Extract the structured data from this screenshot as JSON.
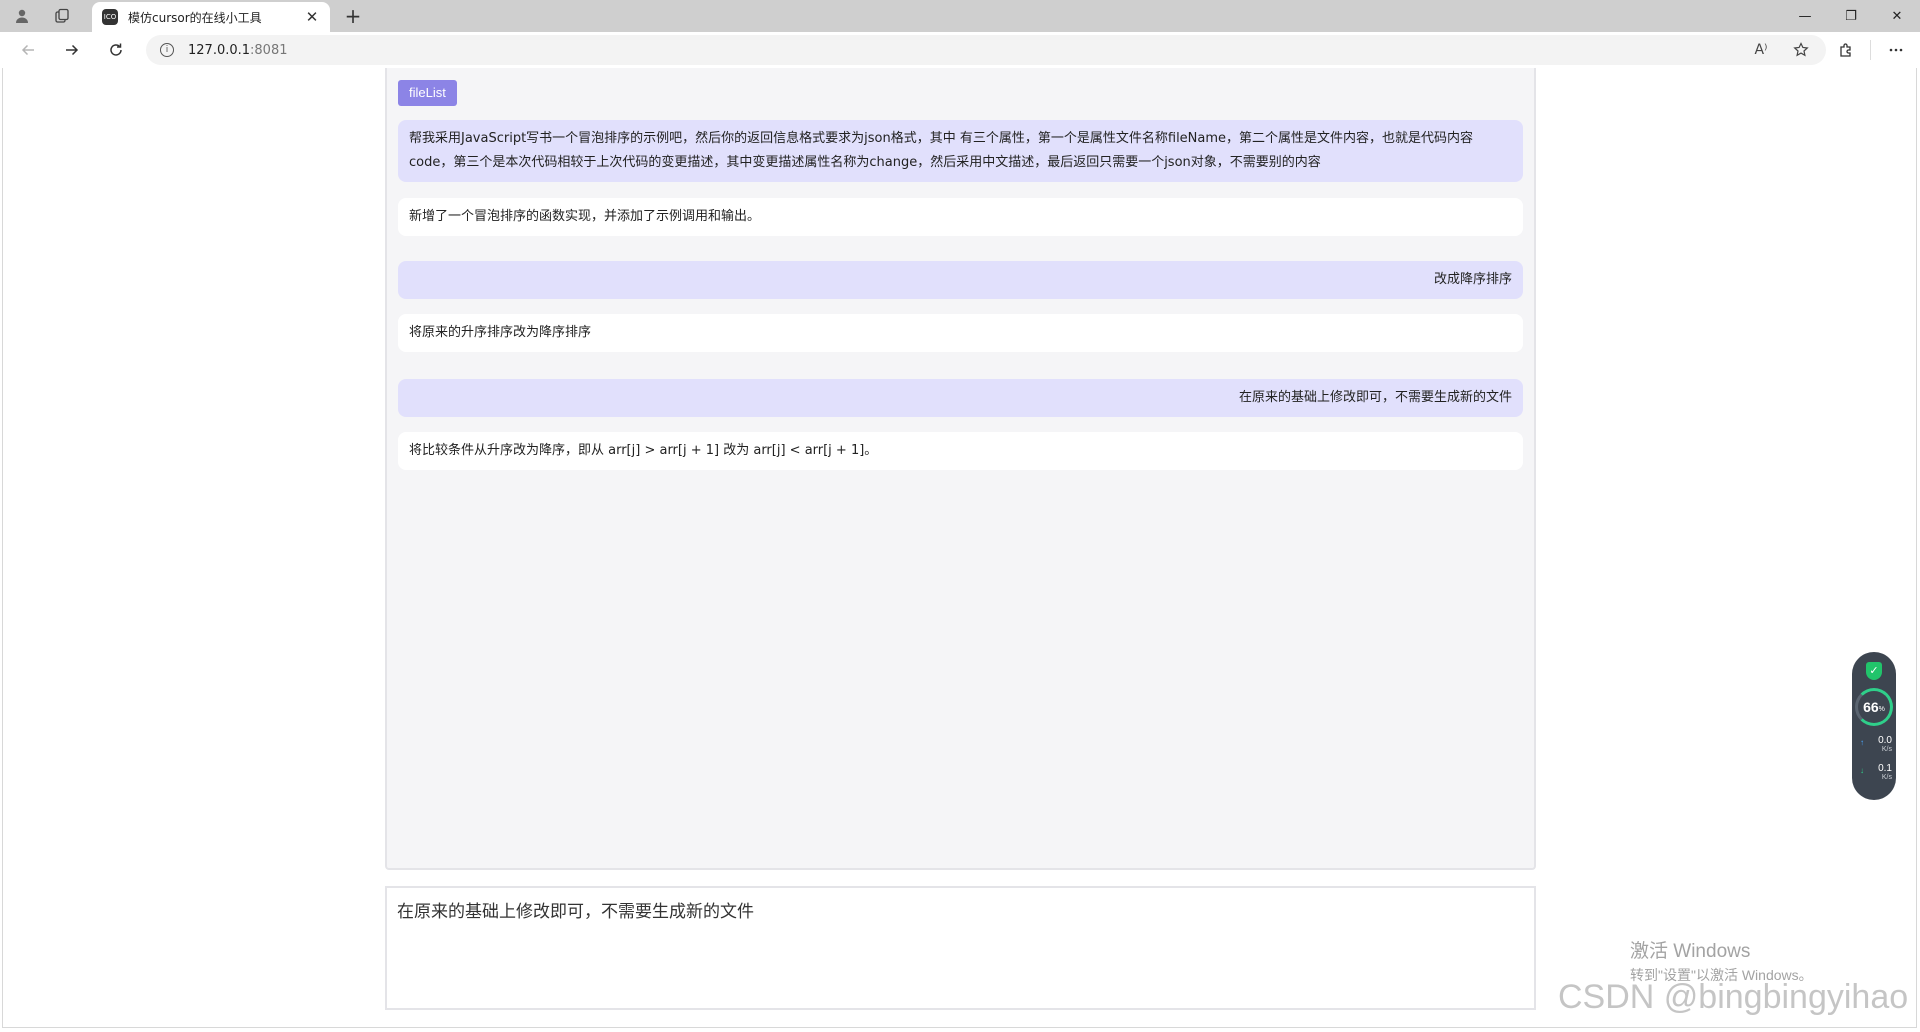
{
  "browser": {
    "tab_title": "模仿cursor的在线小工具",
    "favicon_text": "ICO",
    "tab_close": "✕",
    "new_tab": "+",
    "url_host": "127.0.0.1",
    "url_port": ":8081",
    "read_aloud": "A⁾",
    "window_controls": {
      "minimize": "—",
      "restore": "❐",
      "close": "✕"
    }
  },
  "chat": {
    "filelist_label": "fileList",
    "messages": [
      {
        "role": "user",
        "text": "帮我采用JavaScript写书一个冒泡排序的示例吧，然后你的返回信息格式要求为json格式，其中 有三个属性，第一个是属性文件名称fileName，第二个属性是文件内容，也就是代码内容 code，第三个是本次代码相较于上次代码的变更描述，其中变更描述属性名称为change，然后采用中文描述，最后返回只需要一个json对象，不需要别的内容"
      },
      {
        "role": "bot",
        "text": "新增了一个冒泡排序的函数实现，并添加了示例调用和输出。"
      },
      {
        "role": "user",
        "text": "改成降序排序"
      },
      {
        "role": "bot",
        "text": "将原来的升序排序改为降序排序"
      },
      {
        "role": "user",
        "text": "在原来的基础上修改即可，不需要生成新的文件"
      },
      {
        "role": "bot",
        "text": "将比较条件从升序改为降序，即从 arr[j] > arr[j + 1] 改为 arr[j] < arr[j + 1]。"
      }
    ]
  },
  "input": {
    "value": "在原来的基础上修改即可，不需要生成新的文件"
  },
  "system_monitor": {
    "percent": "66",
    "percent_unit": "%",
    "upload": "0.0",
    "download": "0.1",
    "unit": "K/s"
  },
  "windows_activation": {
    "line1": "激活 Windows",
    "line2": "转到\"设置\"以激活 Windows。"
  },
  "watermark": "CSDN @bingbingyihao",
  "colors": {
    "accent": "#8c84e6",
    "user_bubble": "#e1e0fc",
    "bot_bubble": "#ffffff",
    "panel_bg": "#f5f5f7"
  }
}
